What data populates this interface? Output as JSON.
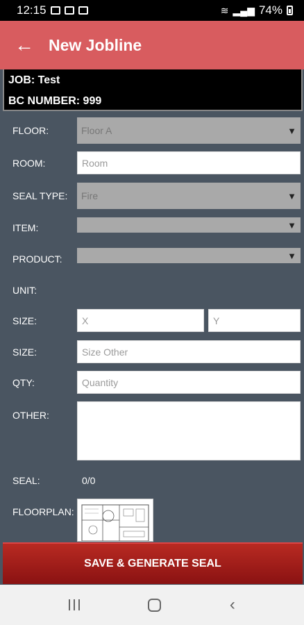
{
  "status_bar": {
    "time": "12:15",
    "battery": "74%"
  },
  "app_bar": {
    "title": "New Jobline"
  },
  "job": {
    "job_line": "JOB: Test",
    "bc_line": "BC NUMBER: 999"
  },
  "form": {
    "floor": {
      "label": "FLOOR:",
      "value": "Floor A"
    },
    "room": {
      "label": "ROOM:",
      "placeholder": "Room"
    },
    "seal_type": {
      "label": "SEAL TYPE:",
      "value": "Fire"
    },
    "item": {
      "label": "ITEM:",
      "value": ""
    },
    "product": {
      "label": "PRODUCT:",
      "value": ""
    },
    "unit": {
      "label": "UNIT:"
    },
    "size": {
      "label": "SIZE:",
      "x_placeholder": "X",
      "y_placeholder": "Y"
    },
    "size_other": {
      "label": "SIZE:",
      "placeholder": "Size Other"
    },
    "qty": {
      "label": "QTY:",
      "placeholder": "Quantity"
    },
    "other": {
      "label": "OTHER:",
      "placeholder": ""
    },
    "seal": {
      "label": "SEAL:",
      "value": "0/0"
    },
    "floorplan": {
      "label": "FLOORPLAN:"
    }
  },
  "actions": {
    "save_label": "SAVE & GENERATE SEAL"
  }
}
